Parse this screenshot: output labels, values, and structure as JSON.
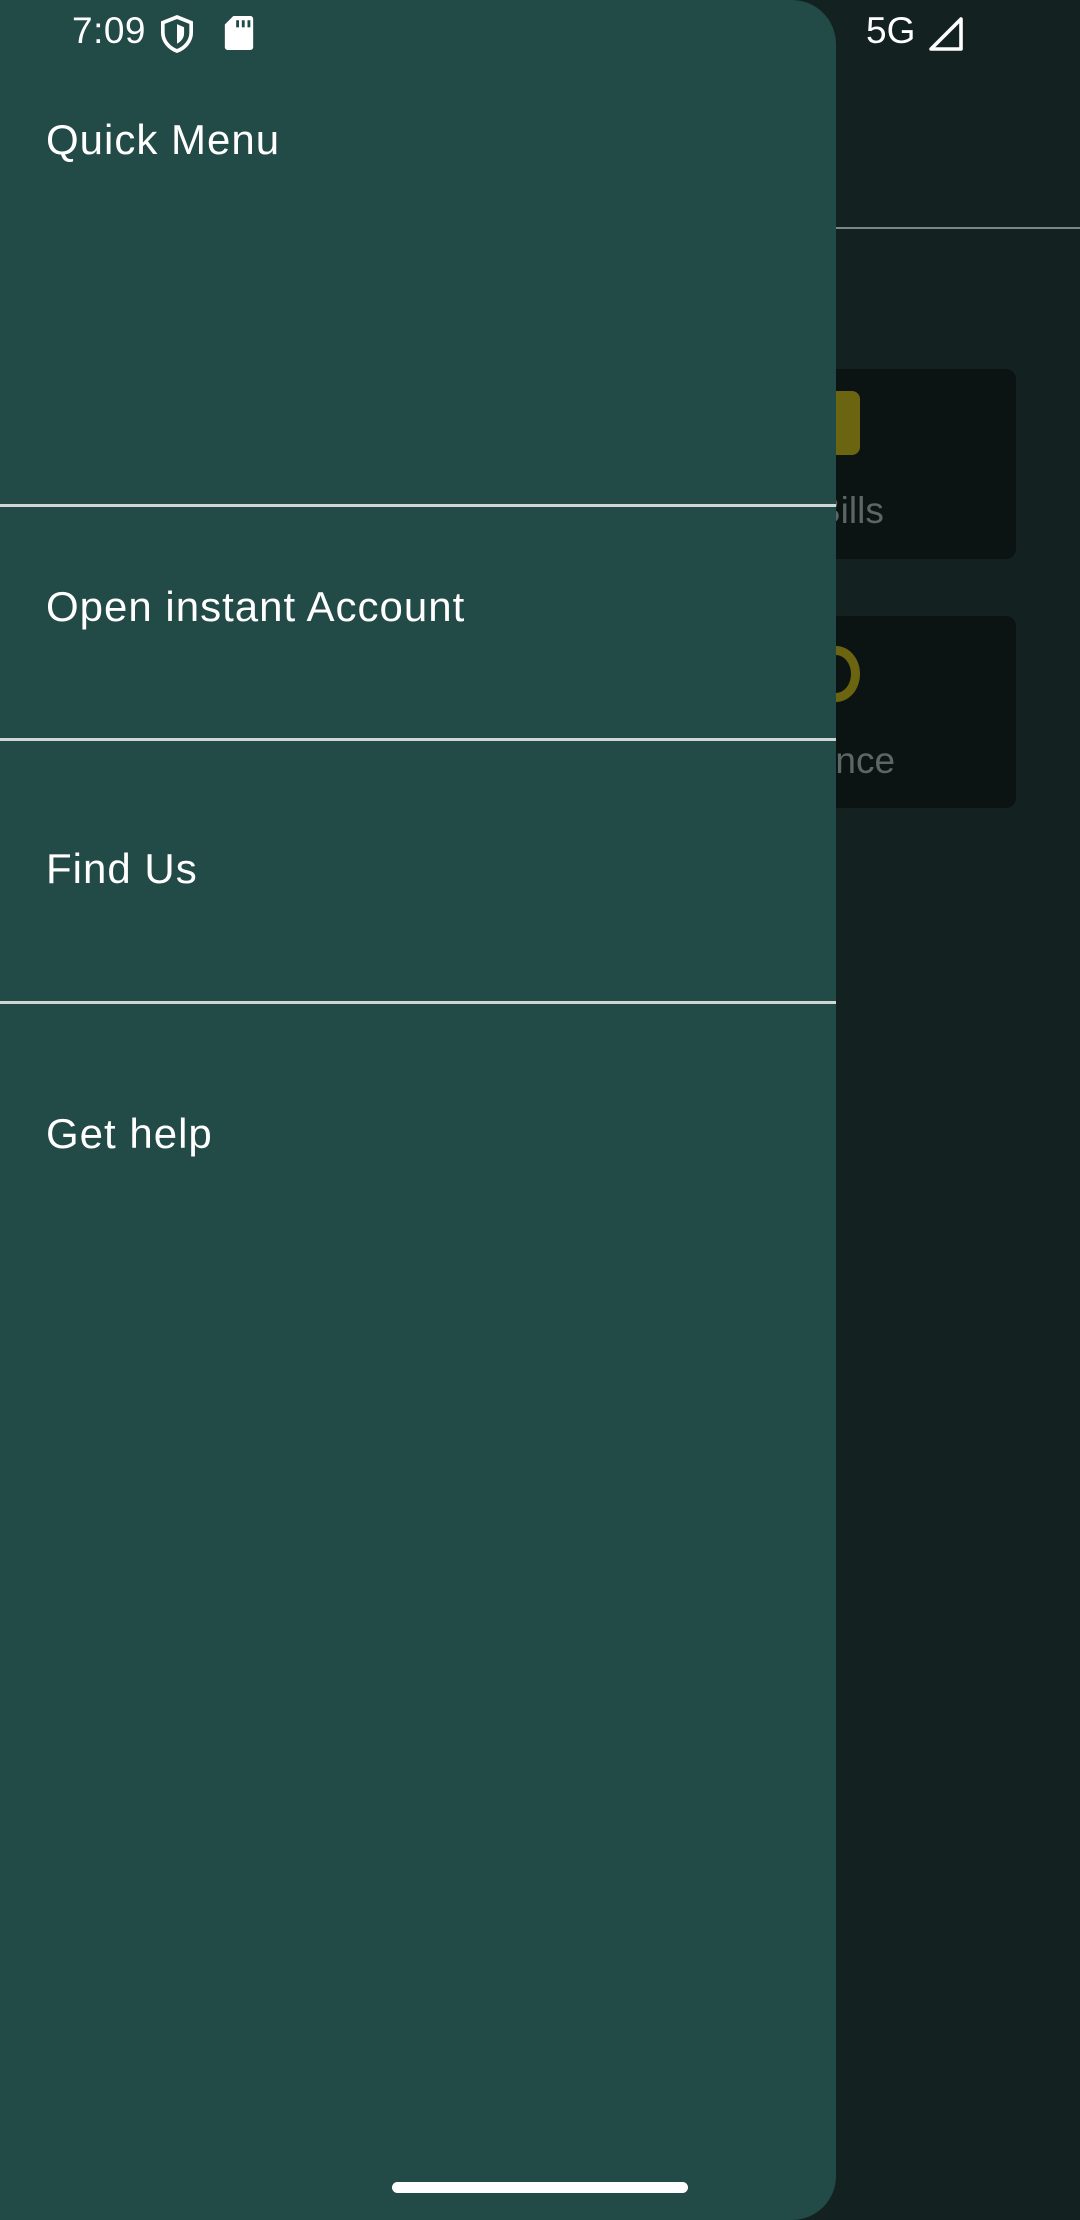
{
  "status_bar": {
    "time": "7:09",
    "network": "5G",
    "icons": [
      "shield-icon",
      "sd-card-icon",
      "cellular-signal-icon"
    ]
  },
  "drawer": {
    "title": "Quick Menu",
    "items": [
      {
        "label": "Open instant Account"
      },
      {
        "label": "Find Us"
      },
      {
        "label": "Get help"
      }
    ]
  },
  "background": {
    "cards": [
      {
        "label": "Bills",
        "icon": "bill-icon"
      },
      {
        "label": "alance",
        "icon": "balance-icon"
      }
    ]
  },
  "colors": {
    "drawer_bg": "#224a47",
    "background": "#132221",
    "divider": "#cfd6d5",
    "accent": "#6b6410"
  }
}
